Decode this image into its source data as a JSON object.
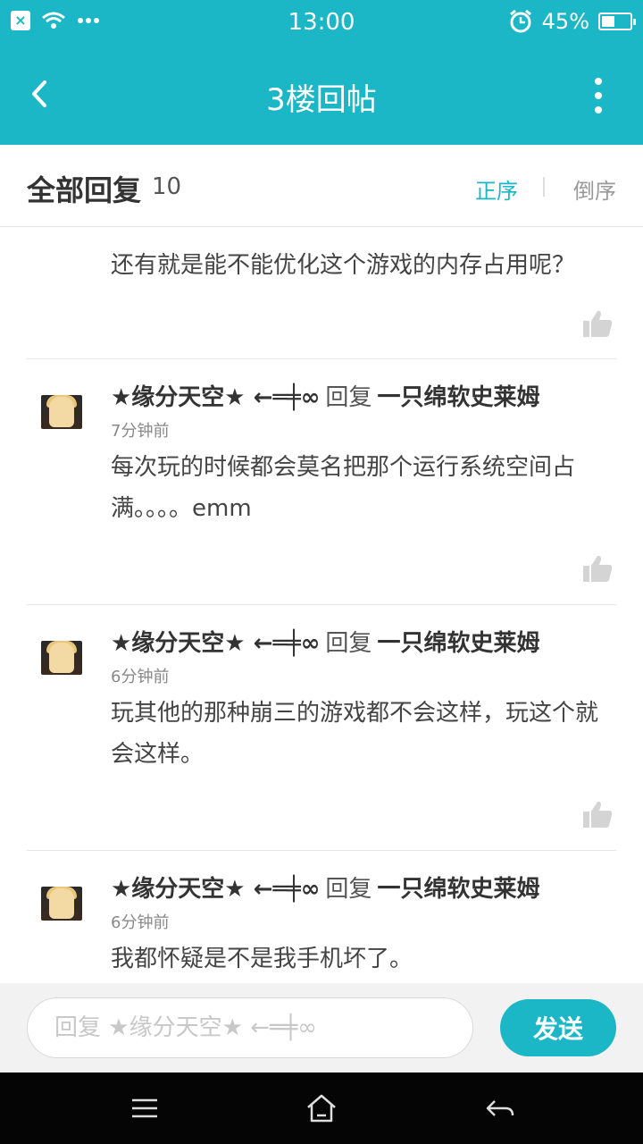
{
  "status_bar": {
    "time": "13:00",
    "battery": "45%",
    "battery_level": 0.45
  },
  "nav": {
    "title": "3楼回帖"
  },
  "sort_bar": {
    "title": "全部回复",
    "count": "10",
    "asc_label": "正序",
    "desc_label": "倒序"
  },
  "posts": [
    {
      "content": "还有就是能不能优化这个游戏的内存占用呢？"
    },
    {
      "author": "★缘分天空★ ←═╪∞",
      "reply_word": "回复",
      "reply_to": "一只绵软史莱姆",
      "time": "7分钟前",
      "content": "每次玩的时候都会莫名把那个运行系统空间占满。。。。emm"
    },
    {
      "author": "★缘分天空★ ←═╪∞",
      "reply_word": "回复",
      "reply_to": "一只绵软史莱姆",
      "time": "6分钟前",
      "content": "玩其他的那种崩三的游戏都不会这样，玩这个就会这样。"
    },
    {
      "author": "★缘分天空★ ←═╪∞",
      "reply_word": "回复",
      "reply_to": "一只绵软史莱姆",
      "time": "6分钟前",
      "content": "我都怀疑是不是我手机坏了。"
    }
  ],
  "reply_bar": {
    "placeholder": "回复 ★缘分天空★ ←═╪∞",
    "send_label": "发送"
  },
  "colors": {
    "accent": "#1bb7c6"
  }
}
